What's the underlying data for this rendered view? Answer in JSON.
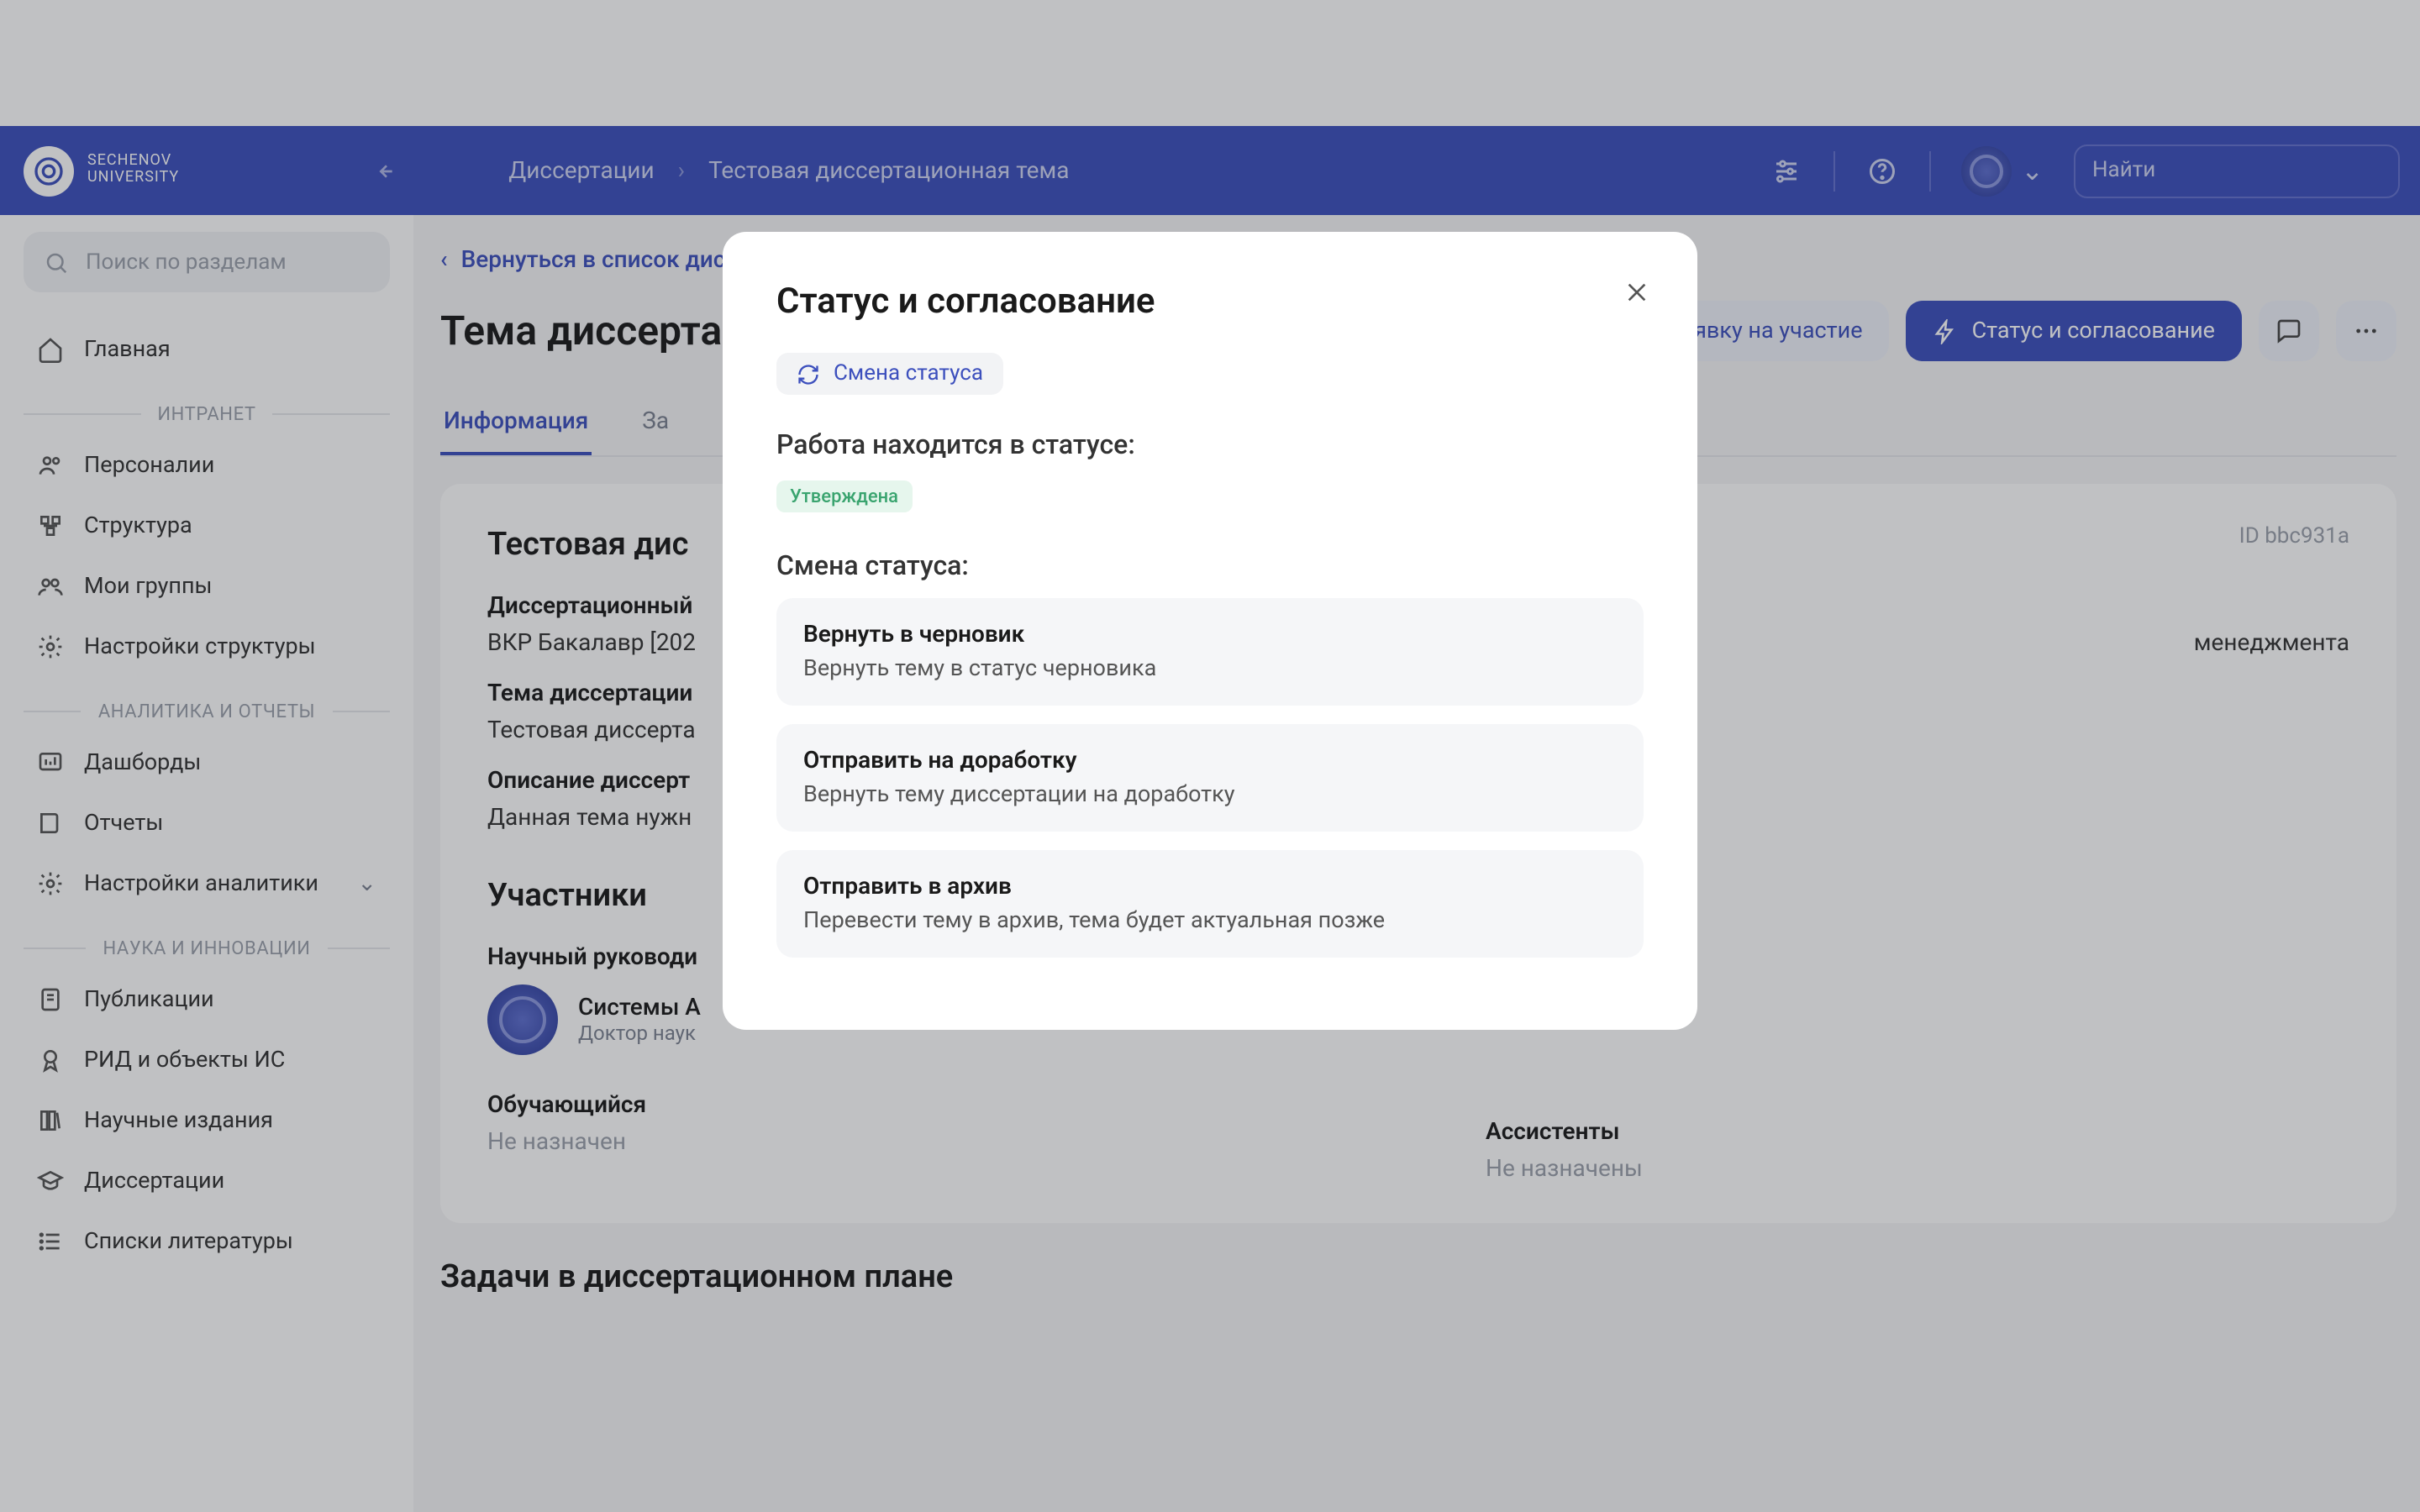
{
  "brand": {
    "line1": "SECHENOV",
    "line2": "UNIVERSITY"
  },
  "breadcrumbs": {
    "item1": "Диссертации",
    "item2": "Тестовая диссертационная тема"
  },
  "top_search_placeholder": "Найти",
  "sidebar_search_placeholder": "Поиск по разделам",
  "sidebar": {
    "home": "Главная",
    "group_intranet": "ИНТРАНЕТ",
    "personalities": "Персоналии",
    "structure": "Структура",
    "my_groups": "Мои группы",
    "structure_settings": "Настройки структуры",
    "group_analytics": "АНАЛИТИКА И ОТЧЕТЫ",
    "dashboards": "Дашборды",
    "reports": "Отчеты",
    "analytics_settings": "Настройки аналитики",
    "group_science": "НАУКА И ИННОВАЦИИ",
    "publications": "Публикации",
    "rid": "РИД и объекты ИС",
    "sci_journals": "Научные издания",
    "dissertations": "Диссертации",
    "biblio": "Списки литературы"
  },
  "backlink": "Вернуться в список диссертаций",
  "page_title": "Тема диссертации",
  "status_badge": "Утверждена",
  "actions": {
    "apply": "Подать заявку на участие",
    "status": "Статус и согласование"
  },
  "tabs": {
    "info": "Информация",
    "applications": "За",
    "plan": "",
    "tasks": ""
  },
  "card": {
    "title": "Тестовая дис",
    "id_label": "ID bbс931a",
    "plan_label": "Диссертационный",
    "plan_value": "ВКР Бакалавр [202",
    "plan_value_tail": "менеджмента",
    "topic_label": "Тема диссертации",
    "topic_value": "Тестовая диссерта",
    "desc_label": "Описание диссерт",
    "desc_value": "Данная тема нужн",
    "participants_title": "Участники",
    "supervisor_label": "Научный руководи",
    "supervisor_name": "Системы А",
    "supervisor_role": "Доктор наук",
    "student_label": "Обучающийся",
    "student_value": "Не назначен",
    "assistants_label": "Ассистенты",
    "assistants_value": "Не назначены"
  },
  "tasks_heading": "Задачи в диссертационном плане",
  "modal": {
    "title": "Статус и согласование",
    "chip": "Смена статуса",
    "status_label": "Работа находится в статусе:",
    "status_value": "Утверждена",
    "change_label": "Смена статуса:",
    "opts": [
      {
        "t": "Вернуть в черновик",
        "d": "Вернуть тему в статус черновика"
      },
      {
        "t": "Отправить на доработку",
        "d": "Вернуть тему диссертации на доработку"
      },
      {
        "t": "Отправить в архив",
        "d": "Перевести тему в архив, тема будет актуальная позже"
      }
    ]
  }
}
